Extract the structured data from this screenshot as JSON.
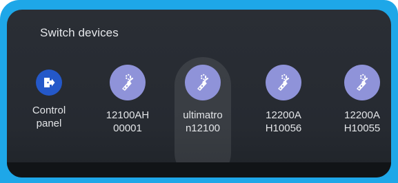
{
  "panel": {
    "title": "Switch devices"
  },
  "devices": [
    {
      "label_line1": "Control",
      "label_line2": "panel",
      "icon": "control-panel-icon",
      "selected": false
    },
    {
      "label_line1": "12100AH",
      "label_line2": "00001",
      "icon": "robot-arm-icon",
      "selected": false
    },
    {
      "label_line1": "ultimatro",
      "label_line2": "n12100",
      "icon": "robot-arm-icon",
      "selected": true
    },
    {
      "label_line1": "12200A",
      "label_line2": "H10056",
      "icon": "robot-arm-icon",
      "selected": false
    },
    {
      "label_line1": "12200A",
      "label_line2": "H10055",
      "icon": "robot-arm-icon",
      "selected": false
    }
  ],
  "colors": {
    "accent_blue": "#1ea7e8",
    "panel_bg": "#2a2e35",
    "device_icon_bg": "#8f93d9",
    "control_icon_bg": "#2458c9",
    "page_indicator": "#2d7be5"
  }
}
